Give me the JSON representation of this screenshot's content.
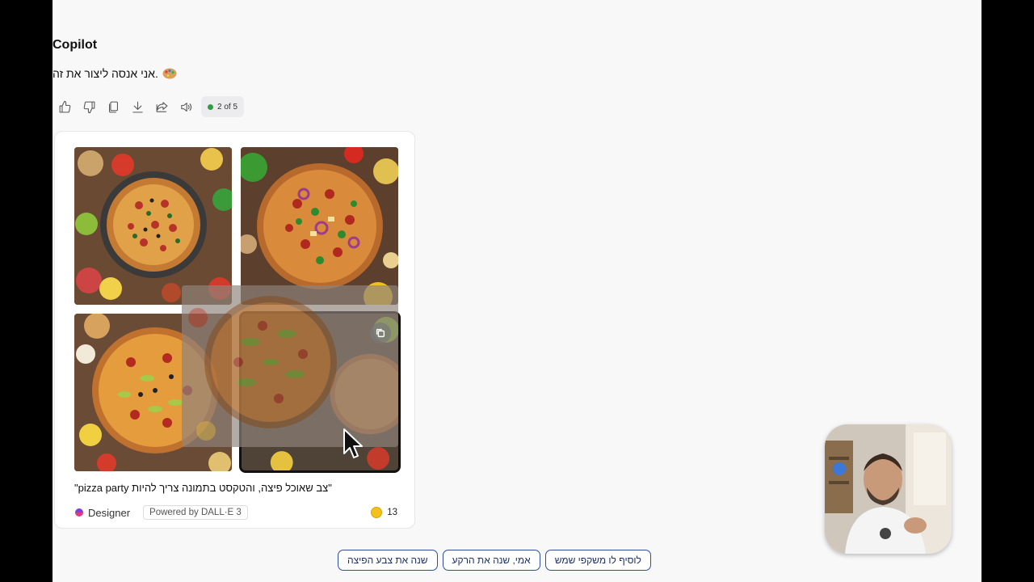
{
  "assistant": {
    "name": "Copilot",
    "message": "אני אנסה ליצור את זה."
  },
  "actions": {
    "icons": [
      "thumbs-up-icon",
      "thumbs-down-icon",
      "copy-icon",
      "download-icon",
      "share-icon",
      "speaker-icon"
    ],
    "counter": "2 of 5",
    "counter_dot_color": "#2e9e44"
  },
  "image_card": {
    "images": [
      "pizza-image-1",
      "pizza-image-2",
      "pizza-image-3",
      "pizza-image-4"
    ],
    "selected_index": 3,
    "prompt": "\"pizza party צב שאוכל פיצה, והטקסט בתמונה צריך להיות\"",
    "brand": "Designer",
    "powered_by": "Powered by DALL·E 3",
    "credits": "13"
  },
  "suggestions": [
    "לוסיף לו משקפי שמש",
    "אמי, שנה את הרקע",
    "שנה את צבע הפיצה"
  ],
  "colors": {
    "accent": "#2f4d9a",
    "coin": "#f2c21a"
  }
}
